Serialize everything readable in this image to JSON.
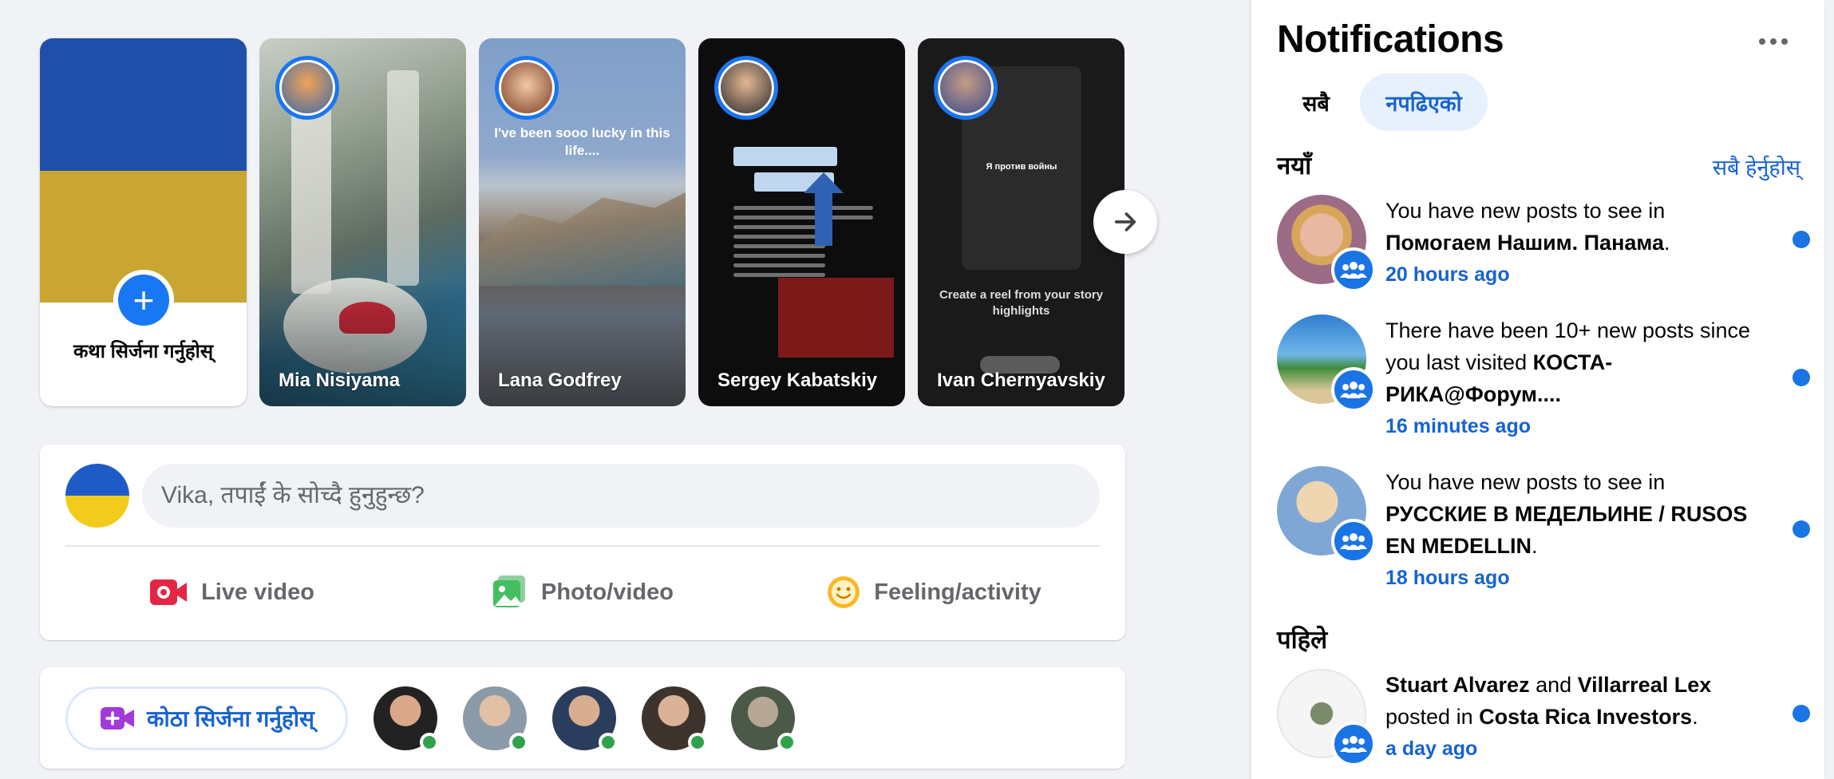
{
  "stories": {
    "create_label": "कथा सिर्जना गर्नुहोस्",
    "items": [
      {
        "name": "Mia Nisiyama"
      },
      {
        "name": "Lana Godfrey",
        "caption": "I've been sooo lucky in this life...."
      },
      {
        "name": "Sergey Kabatskiy"
      },
      {
        "name": "Ivan Chernyavskiy",
        "phone_text": "Я против войны",
        "reel_text": "Create a reel from your story highlights"
      }
    ],
    "next_icon": "arrow-right-icon"
  },
  "composer": {
    "placeholder": "Vika, तपाईं के सोच्दै हुनुहुन्छ?",
    "actions": [
      {
        "label": "Live video",
        "icon": "live-video-icon",
        "color": "#e42645"
      },
      {
        "label": "Photo/video",
        "icon": "photo-icon",
        "color": "#45bd62"
      },
      {
        "label": "Feeling/activity",
        "icon": "smiley-icon",
        "color": "#f7b928"
      }
    ]
  },
  "rooms": {
    "create_label": "कोठा सिर्जना गर्नुहोस्",
    "online_color": "#31a24c"
  },
  "notifications": {
    "title": "Notifications",
    "tabs": {
      "all": "सबै",
      "unread": "नपढिएको"
    },
    "new_heading": "नयाँ",
    "see_all": "सबै हेर्नुहोस्",
    "earlier_heading": "पहिले",
    "items": [
      {
        "pre": "You have new posts to see in ",
        "bold": "Помогаем Нашим. Панама",
        "post": ".",
        "time": "20 hours ago"
      },
      {
        "pre": "There have been 10+ new posts since you last visited ",
        "bold": "КОСТА-РИКА@Форум....",
        "post": "",
        "time": "16 minutes ago"
      },
      {
        "pre": "You have new posts to see in ",
        "bold": "РУССКИЕ В МЕДЕЛЬИНЕ / RUSOS EN MEDELLIN",
        "post": ".",
        "time": "18 hours ago"
      }
    ],
    "earlier_items": [
      {
        "bold1": "Stuart Alvarez",
        "mid": " and ",
        "bold2": "Villarreal Lex",
        "mid2": " posted in ",
        "bold3": "Costa Rica Investors",
        "post": ".",
        "time": "a day ago"
      }
    ],
    "accent": "#1763cf"
  }
}
